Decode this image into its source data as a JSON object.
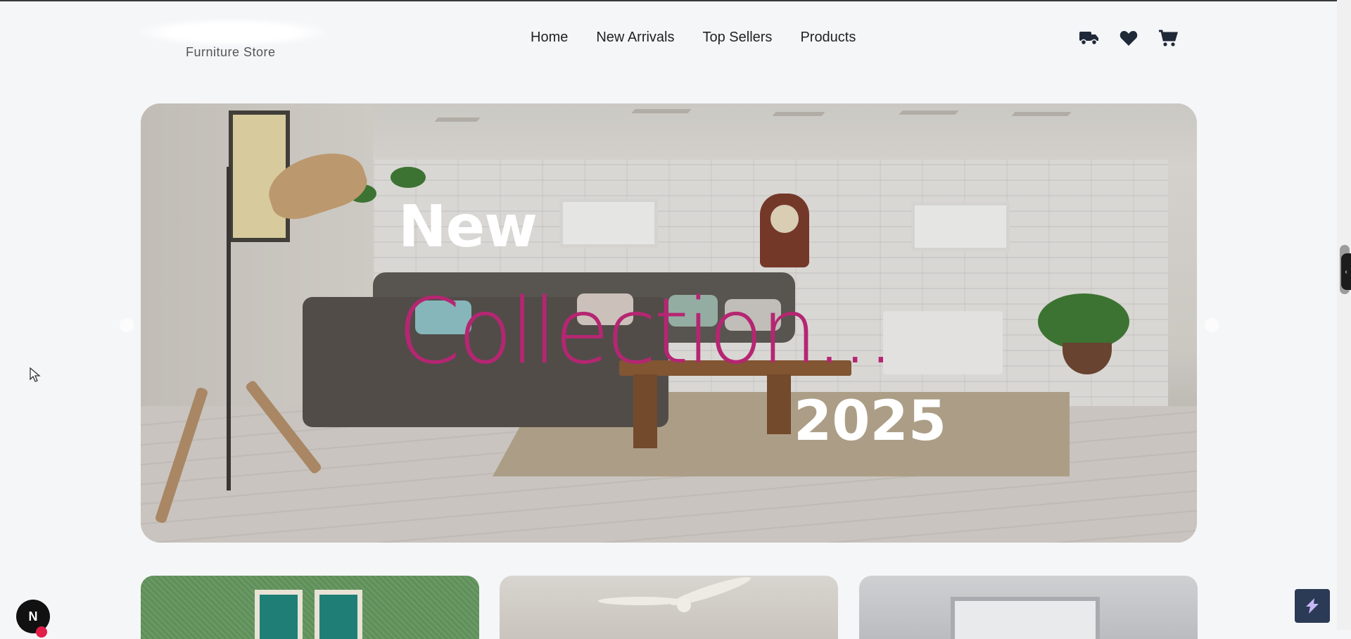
{
  "brand": {
    "subtitle": "Furniture Store"
  },
  "nav": {
    "items": [
      {
        "label": "Home"
      },
      {
        "label": "New Arrivals"
      },
      {
        "label": "Top Sellers"
      },
      {
        "label": "Products"
      }
    ]
  },
  "header_icons": [
    "truck-icon",
    "heart-icon",
    "cart-icon"
  ],
  "hero": {
    "line1": "New",
    "line2": "Collection...",
    "line3": "2025",
    "accent_color": "#b52672"
  },
  "badge": {
    "letter": "N"
  }
}
